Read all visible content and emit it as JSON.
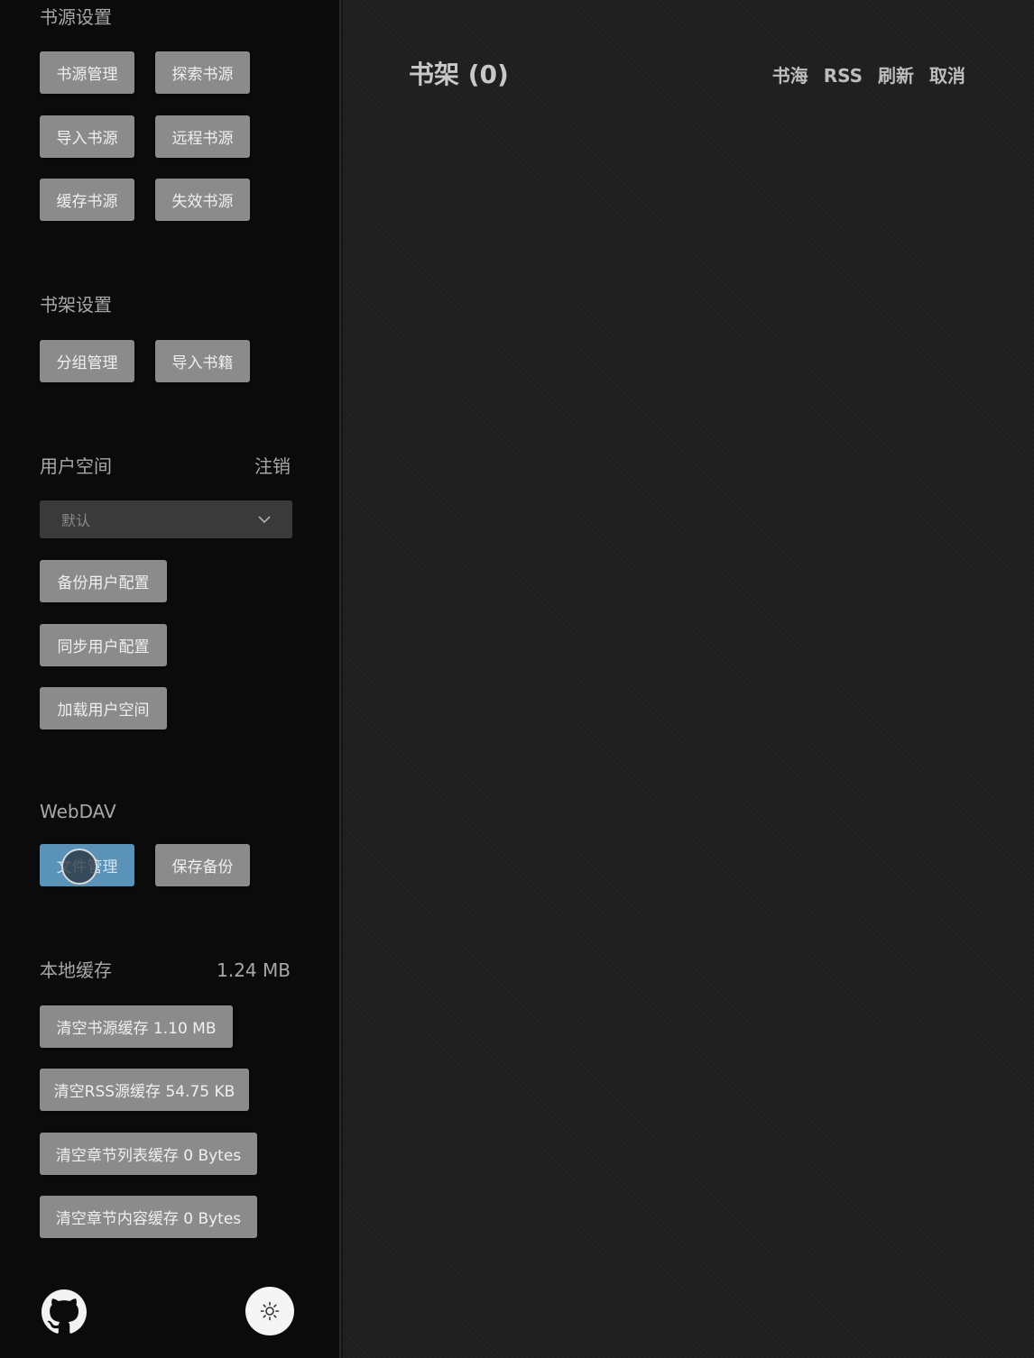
{
  "sidebar": {
    "source_settings": {
      "title": "书源设置",
      "buttons": [
        "书源管理",
        "探索书源",
        "导入书源",
        "远程书源",
        "缓存书源",
        "失效书源"
      ]
    },
    "shelf_settings": {
      "title": "书架设置",
      "buttons": [
        "分组管理",
        "导入书籍"
      ]
    },
    "user_space": {
      "title": "用户空间",
      "logout": "注销",
      "select_value": "默认",
      "buttons": [
        "备份用户配置",
        "同步用户配置",
        "加载用户空间"
      ]
    },
    "webdav": {
      "title": "WebDAV",
      "buttons": [
        "文件管理",
        "保存备份"
      ]
    },
    "local_cache": {
      "title": "本地缓存",
      "size": "1.24 MB",
      "buttons": [
        "清空书源缓存 1.10 MB",
        "清空RSS源缓存 54.75 KB",
        "清空章节列表缓存 0 Bytes",
        "清空章节内容缓存 0 Bytes"
      ]
    },
    "icons": {
      "github": "github-icon",
      "theme": "sun-icon"
    }
  },
  "main": {
    "title": "书架 (0)",
    "nav": [
      "书海",
      "RSS",
      "刷新",
      "取消"
    ]
  },
  "colors": {
    "button_bg": "#8b8b8b",
    "button_active_bg": "#5b92b8",
    "sidebar_bg": "#0b0b0b",
    "main_bg": "#1f1f1f"
  }
}
